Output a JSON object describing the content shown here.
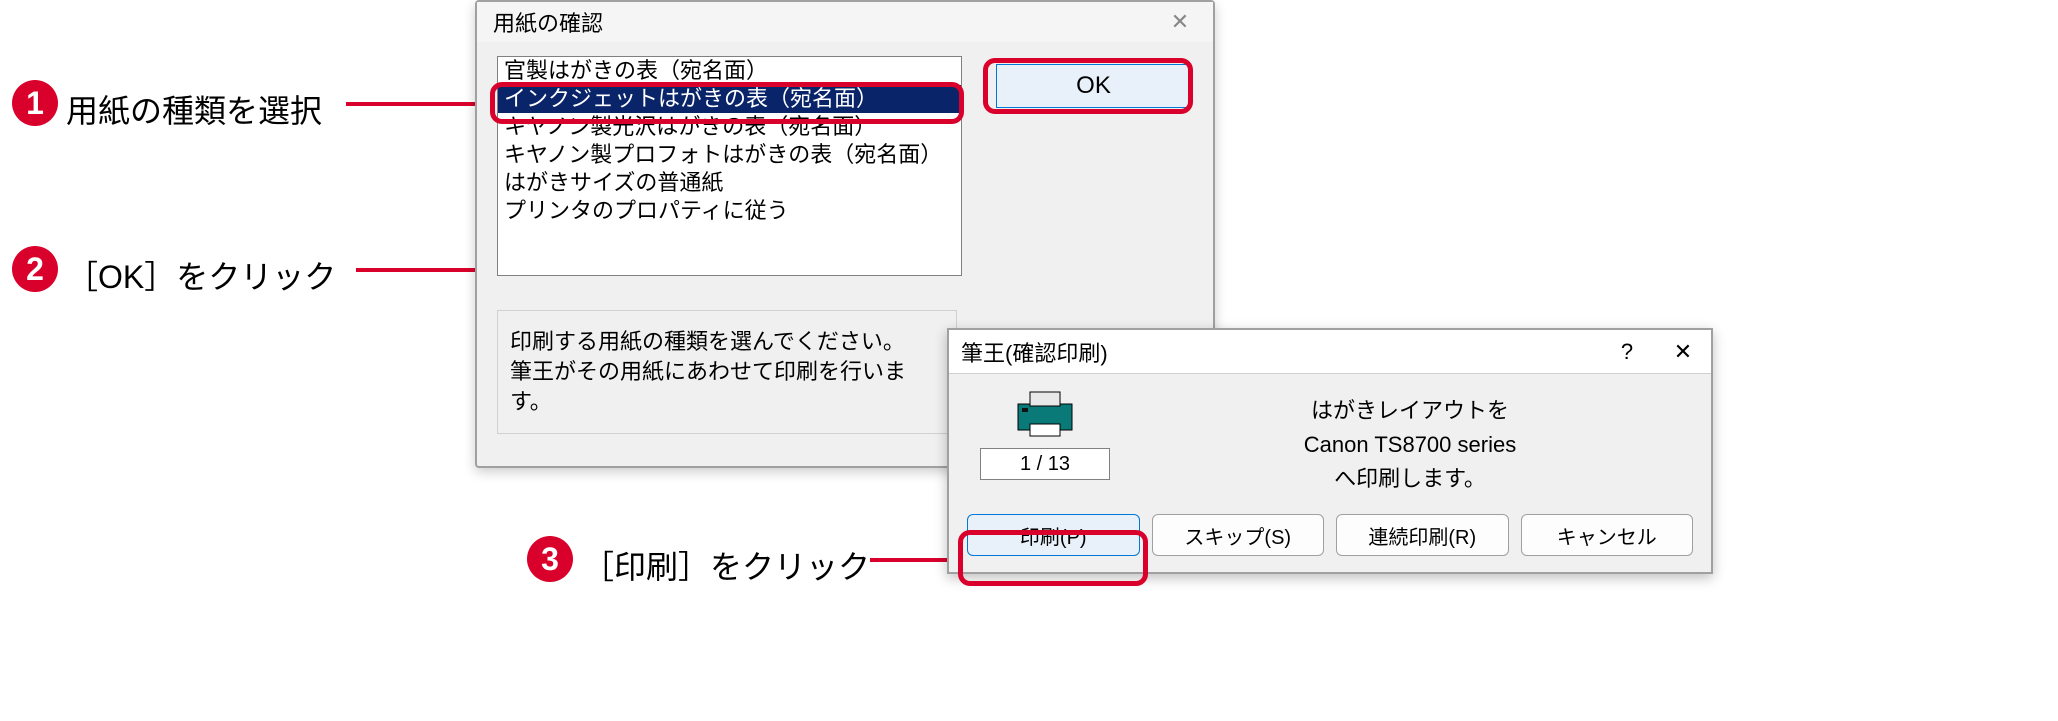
{
  "callouts": {
    "c1": {
      "num": "1",
      "text": "用紙の種類を選択"
    },
    "c2": {
      "num": "2",
      "text": "［OK］をクリック"
    },
    "c3": {
      "num": "3",
      "text": "［印刷］をクリック"
    }
  },
  "dialog1": {
    "title": "用紙の確認",
    "paper_options": {
      "o0": "官製はがきの表（宛名面）",
      "o1": "インクジェットはがきの表（宛名面）",
      "o2": "キヤノン製光沢はがきの表（宛名面）",
      "o3": "キヤノン製プロフォトはがきの表（宛名面）",
      "o4": "はがきサイズの普通紙",
      "o5": "プリンタのプロパティに従う"
    },
    "ok_label": "OK",
    "info_line1": "印刷する用紙の種類を選んでください。",
    "info_line2": "筆王がその用紙にあわせて印刷を行います。"
  },
  "dialog2": {
    "title": "筆王(確認印刷)",
    "help_symbol": "?",
    "close_symbol": "✕",
    "page_counter": "1 / 13",
    "msg_line1": "はがきレイアウトを",
    "msg_line2": "Canon TS8700 series",
    "msg_line3": "へ印刷します。",
    "buttons": {
      "print": "印刷(P)",
      "skip": "スキップ(S)",
      "continuous": "連続印刷(R)",
      "cancel": "キャンセル"
    }
  }
}
